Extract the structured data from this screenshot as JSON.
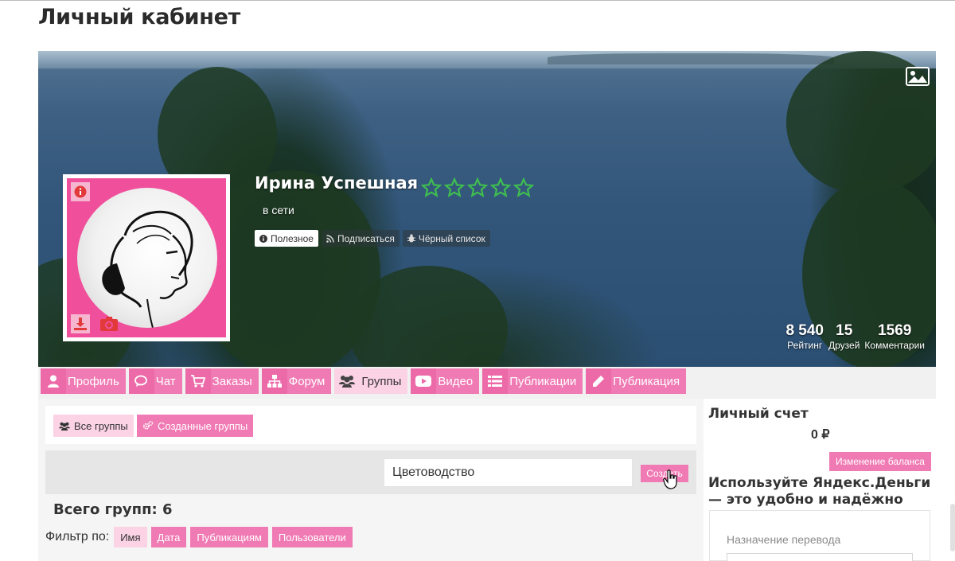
{
  "page": {
    "title": "Личный кабинет"
  },
  "profile": {
    "name": "Ирина Успешная",
    "status": "в сети",
    "rating_stars": {
      "filled": 0,
      "total": 5
    },
    "actions": [
      "Полезное",
      "Подписаться",
      "Чёрный список"
    ],
    "stats": [
      {
        "value": "8 540",
        "label": "Рейтинг"
      },
      {
        "value": "15",
        "label": "Друзей"
      },
      {
        "value": "1569",
        "label": "Комментарии"
      }
    ]
  },
  "nav": {
    "items": [
      {
        "label": "Профиль",
        "icon": "user-icon"
      },
      {
        "label": "Чат",
        "icon": "chat-icon"
      },
      {
        "label": "Заказы",
        "icon": "cart-icon"
      },
      {
        "label": "Форум",
        "icon": "sitemap-icon"
      },
      {
        "label": "Группы",
        "icon": "users-icon",
        "active": true
      },
      {
        "label": "Видео",
        "icon": "youtube-icon"
      },
      {
        "label": "Публикации",
        "icon": "list-icon"
      },
      {
        "label": "Публикация",
        "icon": "pencil-icon"
      }
    ]
  },
  "groups": {
    "tabs": [
      "Все группы",
      "Созданные группы"
    ],
    "input_value": "Цветоводство",
    "create_label": "Создать",
    "total": "Всего групп: 6",
    "filter_label": "Фильтр по:",
    "filters": [
      "Имя",
      "Дата",
      "Публикациям",
      "Пользователи"
    ]
  },
  "account": {
    "title": "Личный счет",
    "balance": "0 ₽",
    "change_balance": "Изменение баланса",
    "yandex_text": "Используйте Яндекс.Деньги — это удобно и надёжно",
    "transfer_label": "Назначение перевода"
  },
  "colors": {
    "accent": "#f07ab3",
    "accent_light": "#fcd3e5",
    "avatar_bg": "#f04f9b",
    "star": "#3fbf4f"
  }
}
